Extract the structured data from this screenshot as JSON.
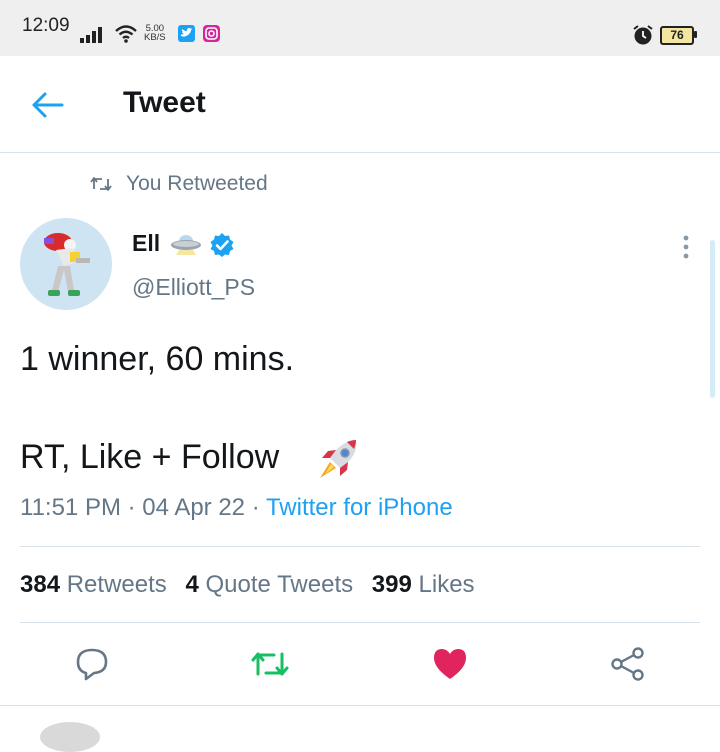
{
  "status_bar": {
    "time": "12:09",
    "speed_value": "5.00",
    "speed_unit": "KB/S",
    "battery": "76",
    "icons": [
      "signal-icon",
      "wifi-icon",
      "twitter-app-icon",
      "instagram-app-icon",
      "alarm-icon",
      "battery-icon"
    ]
  },
  "header": {
    "title": "Tweet",
    "back_icon": "arrow-left-icon"
  },
  "retweet_context": {
    "label": "You Retweeted",
    "icon": "retweet-icon"
  },
  "author": {
    "name": "Ell",
    "handle": "@Elliott_PS",
    "emoji_icon": "ufo-icon",
    "verified_icon": "verified-badge-icon"
  },
  "tweet": {
    "line1": "1 winner, 60 mins.",
    "line2": "RT, Like + Follow",
    "emoji": "rocket-icon"
  },
  "meta": {
    "time": "11:51 PM",
    "date": "04 Apr 22",
    "source": "Twitter for iPhone",
    "separator": " · "
  },
  "stats": {
    "retweets_count": "384",
    "retweets_label": "Retweets",
    "quotes_count": "4",
    "quotes_label": "Quote Tweets",
    "likes_count": "399",
    "likes_label": "Likes"
  },
  "actions": {
    "reply_icon": "reply-icon",
    "retweet_icon": "retweet-icon",
    "like_icon": "heart-icon",
    "share_icon": "share-icon"
  },
  "colors": {
    "accent": "#1da1f2",
    "retweet_green": "#17bf63",
    "like_red": "#e0245e",
    "muted": "#657786",
    "text": "#14171a"
  }
}
